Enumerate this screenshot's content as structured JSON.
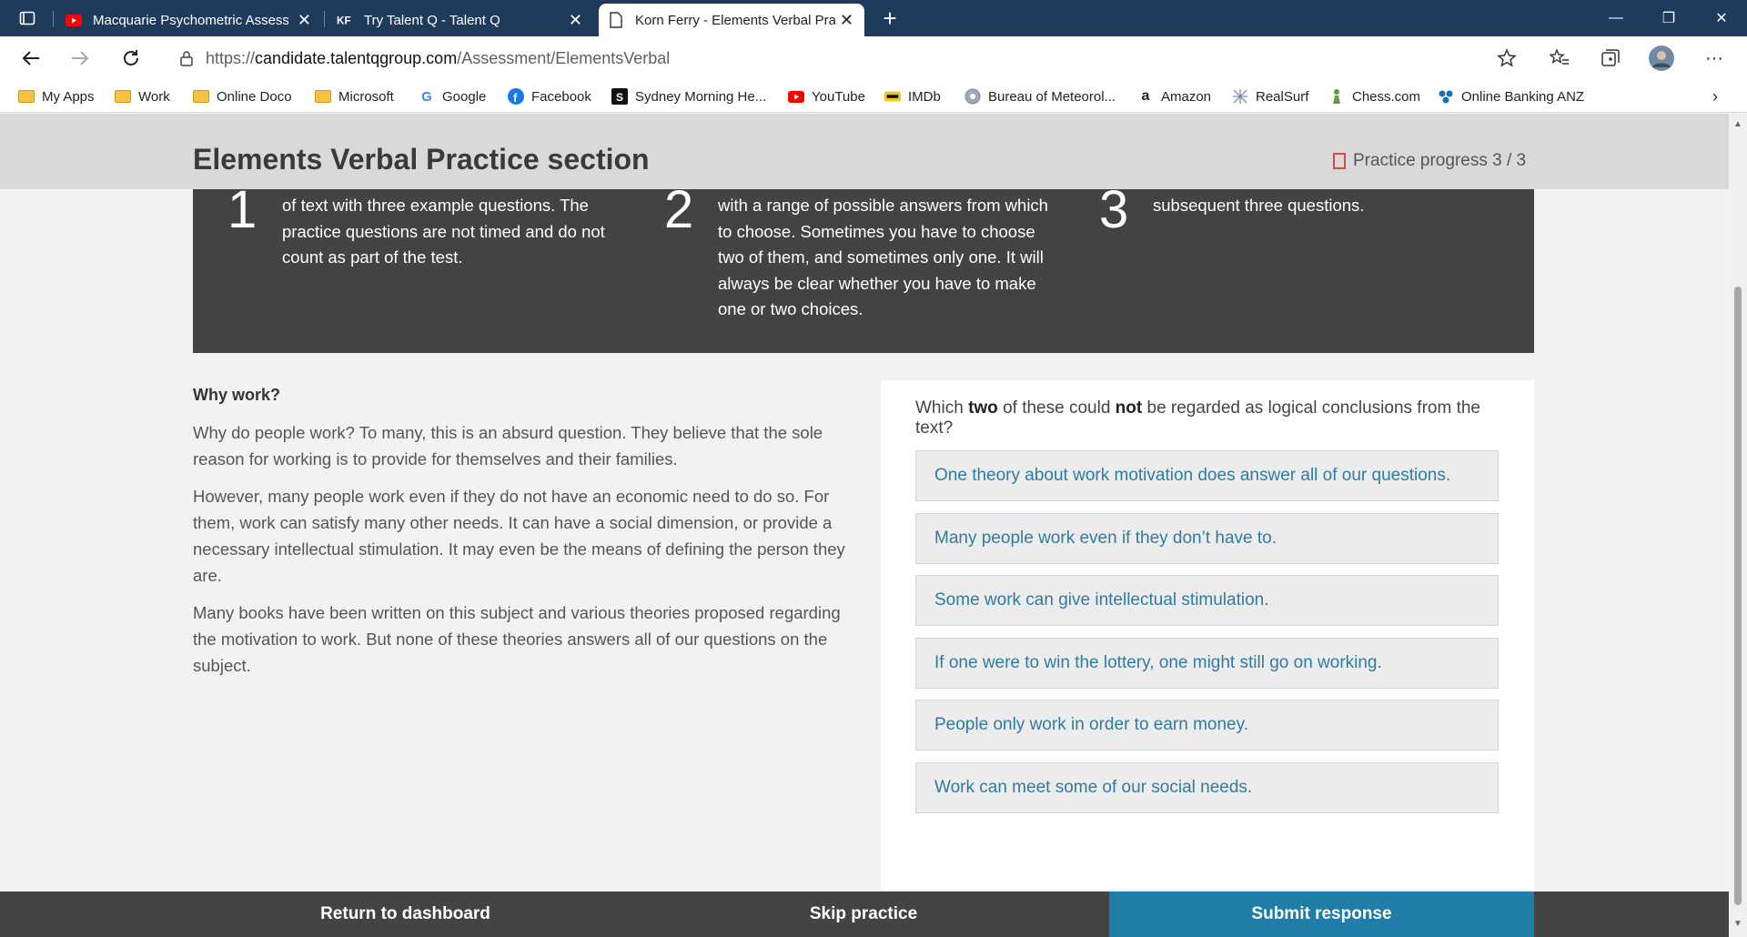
{
  "browser": {
    "tabs": [
      {
        "title": "Macquarie Psychometric Assessm",
        "icon": "youtube-icon"
      },
      {
        "title": "Try Talent Q - Talent Q",
        "icon": "talentq-icon"
      },
      {
        "title": "Korn Ferry - Elements Verbal Pra",
        "icon": "page-icon",
        "active": true
      }
    ],
    "new_tab": "+",
    "window": {
      "minimize": "—",
      "restore": "❐",
      "close": "✕"
    },
    "url_prefix": "https://",
    "url_domain": "candidate.talentqgroup.com",
    "url_path": "/Assessment/ElementsVerbal",
    "bookmarks": [
      {
        "label": "My Apps",
        "icon": "folder-icon"
      },
      {
        "label": "Work",
        "icon": "folder-icon"
      },
      {
        "label": "Online Doco",
        "icon": "folder-icon"
      },
      {
        "label": "Microsoft",
        "icon": "folder-icon"
      },
      {
        "label": "Google",
        "icon": "google-icon"
      },
      {
        "label": "Facebook",
        "icon": "facebook-icon"
      },
      {
        "label": "Sydney Morning He...",
        "icon": "smh-icon"
      },
      {
        "label": "YouTube",
        "icon": "youtube-icon"
      },
      {
        "label": "IMDb",
        "icon": "imdb-icon"
      },
      {
        "label": "Bureau of Meteorol...",
        "icon": "bom-icon"
      },
      {
        "label": "Amazon",
        "icon": "amazon-icon"
      },
      {
        "label": "RealSurf",
        "icon": "realsurf-icon"
      },
      {
        "label": "Chess.com",
        "icon": "chess-icon"
      },
      {
        "label": "Online Banking  ANZ",
        "icon": "anz-icon"
      }
    ]
  },
  "header": {
    "title": "Elements Verbal Practice section",
    "progress": "Practice progress 3 / 3"
  },
  "steps": [
    {
      "num": "1",
      "text_partial": "of text with three example questions. The practice questions are not timed and do not count as part of the test."
    },
    {
      "num": "2",
      "text_partial": "with a range of possible answers from which to choose. Sometimes you have to choose two of them, and sometimes only one. It will always be clear whether you have to make one or two choices."
    },
    {
      "num": "3",
      "text_partial": "subsequent three questions."
    }
  ],
  "passage": {
    "heading": "Why work?",
    "paragraphs": [
      "Why do people work? To many, this is an absurd question. They believe that the sole reason for working is to provide for themselves and their families.",
      "However, many people work even if they do not have an economic need to do so. For them, work can satisfy many other needs. It can have a social dimension, or provide a necessary intellectual stimulation. It may even be the means of defining the person they are.",
      "Many books have been written on this subject and various theories proposed regarding the motivation to work. But none of these theories answers all of our questions on the subject."
    ]
  },
  "question": {
    "pre": "Which ",
    "b1": "two",
    "mid": " of these could ",
    "b2": "not",
    "post": " be regarded as logical conclusions from the text?",
    "options": [
      "One theory about work motivation does answer all of our questions.",
      "Many people work even if they don’t have to.",
      "Some work can give intellectual stimulation.",
      "If one were to win the lottery, one might still go on working.",
      "People only work in order to earn money.",
      "Work can meet some of our social needs."
    ]
  },
  "footer": {
    "return": "Return to dashboard",
    "skip": "Skip practice",
    "submit": "Submit response"
  },
  "colors": {
    "accent": "#1f7da7",
    "option_text": "#2f7ca0",
    "dark_panel": "#434343"
  }
}
